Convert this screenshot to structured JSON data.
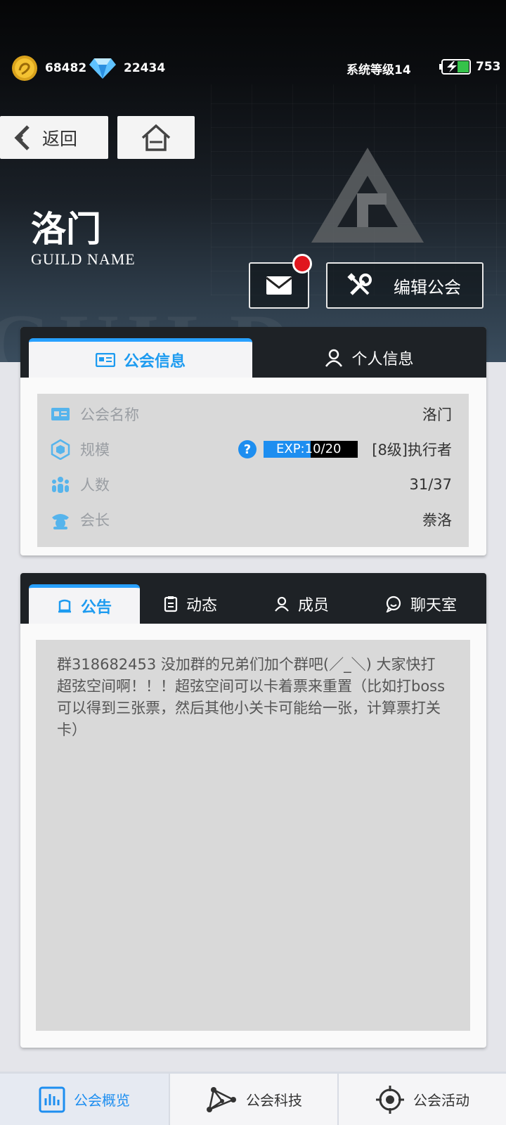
{
  "status": {
    "coins": "68482",
    "gems": "22434",
    "system_level": "系统等级14",
    "energy": "753"
  },
  "nav": {
    "back_label": "返回"
  },
  "guild": {
    "name": "洛门",
    "subtitle": "GUILD NAME",
    "edit_label": "编辑公会"
  },
  "info_tabs": {
    "guild_info": "公会信息",
    "personal_info": "个人信息"
  },
  "info": {
    "name_label": "公会名称",
    "name_value": "洛门",
    "scale_label": "规模",
    "exp_text": "EXP:10/20",
    "exp_progress": 0.5,
    "level_value": "[8级]执行者",
    "members_label": "人数",
    "members_value": "31/37",
    "leader_label": "会长",
    "leader_value": "䄅洛"
  },
  "content_tabs": {
    "notice": "公告",
    "activity": "动态",
    "members": "成员",
    "chat": "聊天室"
  },
  "notice_text": "群318682453  没加群的兄弟们加个群吧(／_＼) 大家快打超弦空间啊！！！超弦空间可以卡着票来重置（比如打boss可以得到三张票，然后其他小关卡可能给一张，计算票打关卡）",
  "bottom_nav": {
    "overview": "公会概览",
    "tech": "公会科技",
    "events": "公会活动"
  },
  "colors": {
    "accent": "#1d8ef0",
    "header_dark": "#1e2226",
    "badge_red": "#e0161e"
  }
}
